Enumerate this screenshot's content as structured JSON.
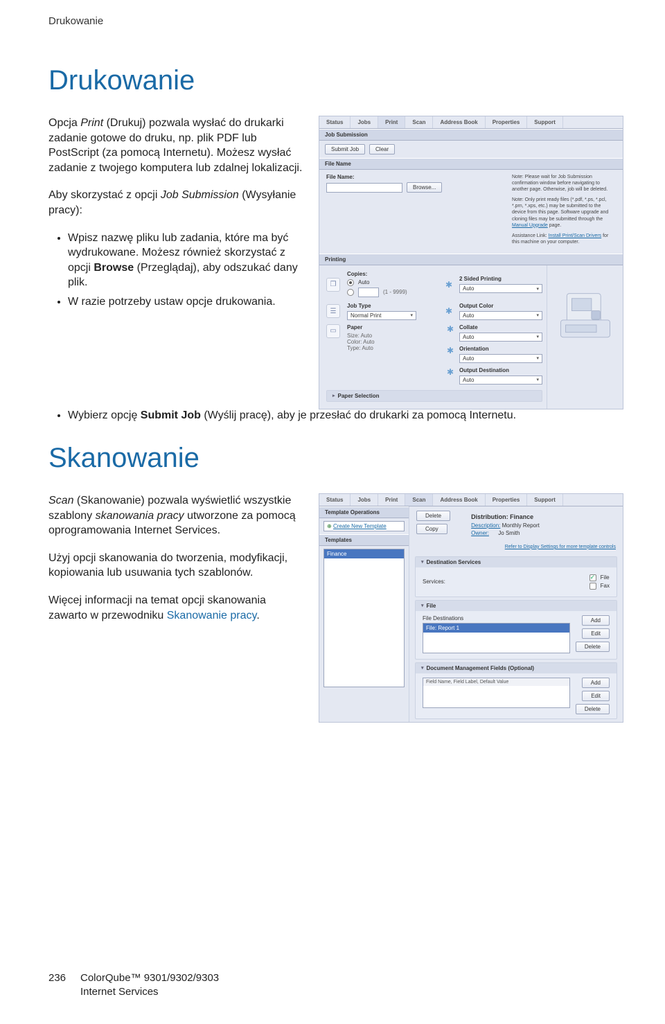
{
  "crumb": "Drukowanie",
  "h1_print": "Drukowanie",
  "print_p1_a": "Opcja ",
  "print_p1_b": "Print",
  "print_p1_c": " (Drukuj) pozwala wysłać do drukarki zadanie gotowe do druku, np. plik PDF lub PostScript (za pomocą Internetu). Możesz wysłać zadanie z twojego komputera lub zdalnej lokalizacji.",
  "print_p2_a": "Aby skorzystać z opcji ",
  "print_p2_b": "Job Submission",
  "print_p2_c": " (Wysyłanie pracy):",
  "print_li1_a": "Wpisz nazwę pliku lub zadania, które ma być wydrukowane. Możesz również skorzystać z opcji ",
  "print_li1_b": "Browse",
  "print_li1_c": " (Przeglądaj), aby odszukać dany plik.",
  "print_li2": "W razie potrzeby ustaw opcje drukowania.",
  "print_li3_a": "Wybierz opcję ",
  "print_li3_b": "Submit Job",
  "print_li3_c": " (Wyślij pracę), aby je przesłać do drukarki za pomocą Internetu.",
  "h1_scan": "Skanowanie",
  "scan_p1_a": "Scan",
  "scan_p1_b": " (Skanowanie) pozwala wyświetlić wszystkie szablony ",
  "scan_p1_c": "skanowania pracy",
  "scan_p1_d": " utworzone za pomocą oprogramowania Internet Services.",
  "scan_p2": "Użyj opcji skanowania do tworzenia, modyfikacji, kopiowania lub usuwania tych szablonów.",
  "scan_p3_a": "Więcej informacji na temat opcji skanowania zawarto w przewodniku ",
  "scan_p3_b": "Skanowanie pracy",
  "scan_p3_c": ".",
  "footer_page": "236",
  "footer_l1": "ColorQube™ 9301/9302/9303",
  "footer_l2": "Internet Services",
  "tabs": [
    "Status",
    "Jobs",
    "Print",
    "Scan",
    "Address Book",
    "Properties",
    "Support"
  ],
  "print_shot": {
    "title": "Job Submission",
    "btn_submit": "Submit Job",
    "btn_clear": "Clear",
    "bar_filename": "File Name",
    "lbl_filename": "File Name:",
    "btn_browse": "Browse...",
    "note1": "Note: Please wait for Job Submission confirmation window before navigating to another page. Otherwise, job will be deleted.",
    "note2_a": "Note: Only print ready files (*.pdf, *.ps, *.pcl, *.prn, *.xps, etc.) may be submitted to the device from this page. Software upgrade and cloning files may be submitted through the ",
    "note2_b": "Manual Upgrade",
    "note2_c": " page.",
    "note3_a": "Assistance Link: ",
    "note3_b": "Install Print/Scan Drivers",
    "note3_c": " for this machine on your computer.",
    "bar_printing": "Printing",
    "copies": "Copies:",
    "copies_auto": "Auto",
    "copies_range": "(1 - 9999)",
    "jobtype": "Job Type",
    "jobtype_val": "Normal Print",
    "paper": "Paper",
    "paper_l1": "Size: Auto",
    "paper_l2": "Color: Auto",
    "paper_l3": "Type: Auto",
    "sided": "2 Sided Printing",
    "auto": "Auto",
    "output_color": "Output Color",
    "collate": "Collate",
    "orientation": "Orientation",
    "dest": "Output Destination",
    "papersel": "Paper Selection"
  },
  "scan_shot": {
    "tops": "Template Operations",
    "create": "Create New Template",
    "templates": "Templates",
    "tmpl_item": "Finance",
    "btn_delete": "Delete",
    "btn_copy": "Copy",
    "dist": "Distribution: Finance",
    "desc_k": "Description:",
    "desc_v": "Monthly Report",
    "owner_k": "Owner:",
    "owner_v": "Jo Smith",
    "refer": "Refer to Display Settings for more template controls",
    "dest_services": "Destination Services",
    "services": "Services:",
    "chk_file": "File",
    "chk_fax": "Fax",
    "file": "File",
    "file_dest": "File Destinations",
    "file_item": "File: Report 1",
    "btn_add": "Add",
    "btn_edit": "Edit",
    "btn_delete2": "Delete",
    "dmf": "Document Management Fields (Optional)",
    "dmf_head": "Field Name, Field Label, Default Value"
  }
}
